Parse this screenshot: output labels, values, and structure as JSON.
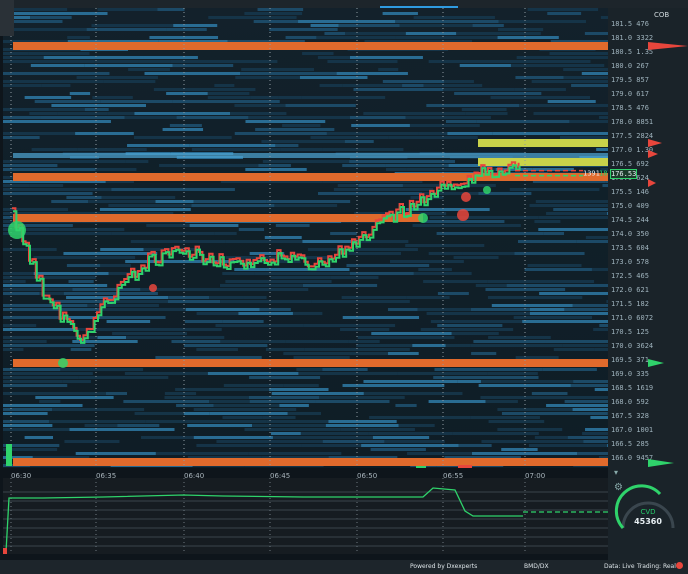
{
  "panel": {
    "title": "COB"
  },
  "price_ladder": [
    {
      "price": "181.5",
      "vol": "476"
    },
    {
      "price": "181.0",
      "vol": "3322"
    },
    {
      "price": "180.5",
      "vol": "1.35"
    },
    {
      "price": "180.0",
      "vol": "267"
    },
    {
      "price": "179.5",
      "vol": "857"
    },
    {
      "price": "179.0",
      "vol": "617"
    },
    {
      "price": "178.5",
      "vol": "476"
    },
    {
      "price": "178.0",
      "vol": "8851"
    },
    {
      "price": "177.5",
      "vol": "2824"
    },
    {
      "price": "177.0",
      "vol": "1.30"
    },
    {
      "price": "176.5",
      "vol": "692"
    },
    {
      "price": "176.0",
      "vol": "624"
    },
    {
      "price": "175.5",
      "vol": "146"
    },
    {
      "price": "175.0",
      "vol": "409"
    },
    {
      "price": "174.5",
      "vol": "244"
    },
    {
      "price": "174.0",
      "vol": "350"
    },
    {
      "price": "173.5",
      "vol": "604"
    },
    {
      "price": "173.0",
      "vol": "578"
    },
    {
      "price": "172.5",
      "vol": "465"
    },
    {
      "price": "172.0",
      "vol": "621"
    },
    {
      "price": "171.5",
      "vol": "182"
    },
    {
      "price": "171.0",
      "vol": "6072"
    },
    {
      "price": "170.5",
      "vol": "125"
    },
    {
      "price": "170.0",
      "vol": "3624"
    },
    {
      "price": "169.5",
      "vol": "371"
    },
    {
      "price": "169.0",
      "vol": "335"
    },
    {
      "price": "168.5",
      "vol": "1619"
    },
    {
      "price": "168.0",
      "vol": "592"
    },
    {
      "price": "167.5",
      "vol": "328"
    },
    {
      "price": "167.0",
      "vol": "1001"
    },
    {
      "price": "166.5",
      "vol": "285"
    },
    {
      "price": "166.0",
      "vol": "9457"
    }
  ],
  "last_price": {
    "qty": "1391",
    "bid": "1881",
    "price": "176.53"
  },
  "time_labels": [
    "06:30",
    "06:35",
    "06:40",
    "06:45",
    "06:50",
    "06:55",
    "07:00"
  ],
  "gauge": {
    "label": "CVD",
    "value": "45360"
  },
  "footer": {
    "powered": "Powered by Dxexperts",
    "symbol": "BMD/DX",
    "data": "Data: Live",
    "trading": "Trading: Real"
  },
  "colors": {
    "bid": "#2fd36b",
    "ask": "#e8463c",
    "wall": "#e06a2c",
    "wall_alt": "#c8d24a",
    "accent": "#2f9be0"
  },
  "chart_data": {
    "type": "line",
    "x": [
      "06:30",
      "06:32",
      "06:34",
      "06:36",
      "06:38",
      "06:40",
      "06:42",
      "06:44",
      "06:46",
      "06:48",
      "06:50",
      "06:52",
      "06:54",
      "06:56",
      "06:58",
      "07:00"
    ],
    "series": [
      {
        "values": [
          174.5,
          171.6,
          170.3,
          171.8,
          172.9,
          173.2,
          173.0,
          172.7,
          173.1,
          172.8,
          173.4,
          174.3,
          175.0,
          175.6,
          176.0,
          176.2
        ]
      }
    ],
    "ylim": [
      166.0,
      181.5
    ]
  }
}
